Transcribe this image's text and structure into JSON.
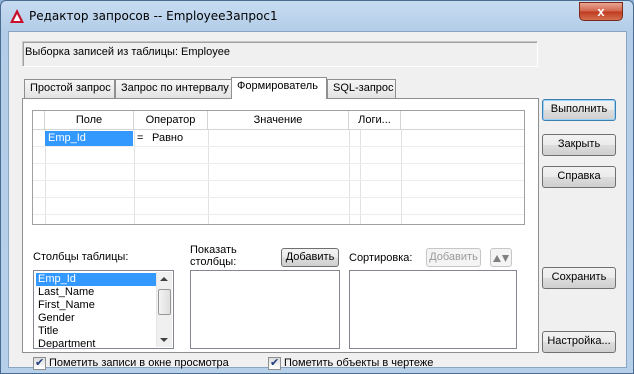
{
  "window": {
    "title": "Редактор запросов -- Employee3апрос1",
    "close_glyph": "x"
  },
  "info": {
    "text": "Выборка записей из таблицы:  Employee"
  },
  "tabs": [
    {
      "label": "Простой запрос",
      "active": false
    },
    {
      "label": "Запрос по интервалу",
      "active": false
    },
    {
      "label": "Формирователь",
      "active": true
    },
    {
      "label": "SQL-запрос",
      "active": false
    }
  ],
  "grid": {
    "columns": [
      "Поле",
      "Оператор",
      "Значение",
      "Логи..."
    ],
    "rows": [
      {
        "field": "Emp_Id",
        "op_symbol": "=",
        "op_name": "Равно",
        "value": "",
        "logic": ""
      }
    ]
  },
  "table_columns": {
    "label": "Столбцы таблицы:",
    "items": [
      "Emp_Id",
      "Last_Name",
      "First_Name",
      "Gender",
      "Title",
      "Department"
    ],
    "selected_index": 0
  },
  "show_columns": {
    "label_line1": "Показать",
    "label_line2": "столбцы:",
    "add_button": "Добавить"
  },
  "sort": {
    "label": "Сортировка:",
    "add_button": "Добавить",
    "sort_icon": "up-down-arrows"
  },
  "checkboxes": {
    "mark_in_preview": {
      "label": "Пометить записи в окне просмотра",
      "checked": true
    },
    "mark_in_drawing": {
      "label": "Пометить объекты в чертеже",
      "checked": true
    }
  },
  "buttons": {
    "execute": "Выполнить",
    "close": "Закрыть",
    "help": "Справка",
    "save": "Сохранить",
    "settings": "Настройка..."
  },
  "colors": {
    "selection": "#3399ff",
    "title_bar": "#b9d1ea"
  }
}
